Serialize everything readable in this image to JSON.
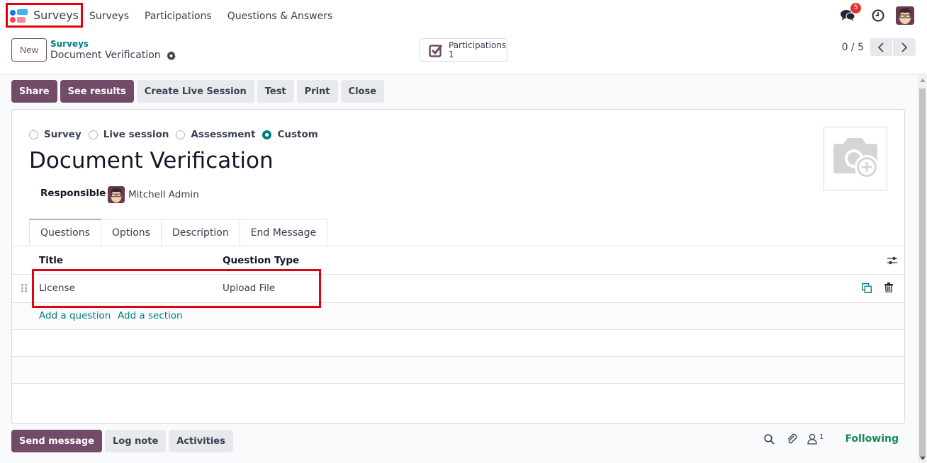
{
  "navbar": {
    "brand": "Surveys",
    "menu": [
      "Surveys",
      "Participations",
      "Questions & Answers"
    ],
    "messages_badge": "5",
    "icons": [
      "chat-icon",
      "clock-icon",
      "user-avatar"
    ]
  },
  "control_panel": {
    "new_label": "New",
    "breadcrumb_parent": "Surveys",
    "breadcrumb_current": "Document Verification",
    "stat_button": {
      "label": "Participations",
      "value": "1"
    },
    "pager": "0 / 5"
  },
  "actions": {
    "share": "Share",
    "see_results": "See results",
    "create_live_session": "Create Live Session",
    "test": "Test",
    "print": "Print",
    "close": "Close"
  },
  "form": {
    "survey_types": [
      {
        "label": "Survey",
        "checked": false
      },
      {
        "label": "Live session",
        "checked": false
      },
      {
        "label": "Assessment",
        "checked": false
      },
      {
        "label": "Custom",
        "checked": true
      }
    ],
    "title": "Document Verification",
    "responsible_label": "Responsible",
    "responsible_value": "Mitchell Admin",
    "tabs": [
      "Questions",
      "Options",
      "Description",
      "End Message"
    ],
    "active_tab": "Questions",
    "list": {
      "columns": [
        "Title",
        "Question Type"
      ],
      "rows": [
        {
          "title": "License",
          "type": "Upload File"
        }
      ],
      "add_question": "Add a question",
      "add_section": "Add a section"
    }
  },
  "chatter": {
    "send_message": "Send message",
    "log_note": "Log note",
    "activities": "Activities",
    "followers_count": "1",
    "following": "Following"
  },
  "colors": {
    "primary": "#714b67",
    "link": "#017e84",
    "highlight": "#e3000f",
    "following": "#198754"
  }
}
